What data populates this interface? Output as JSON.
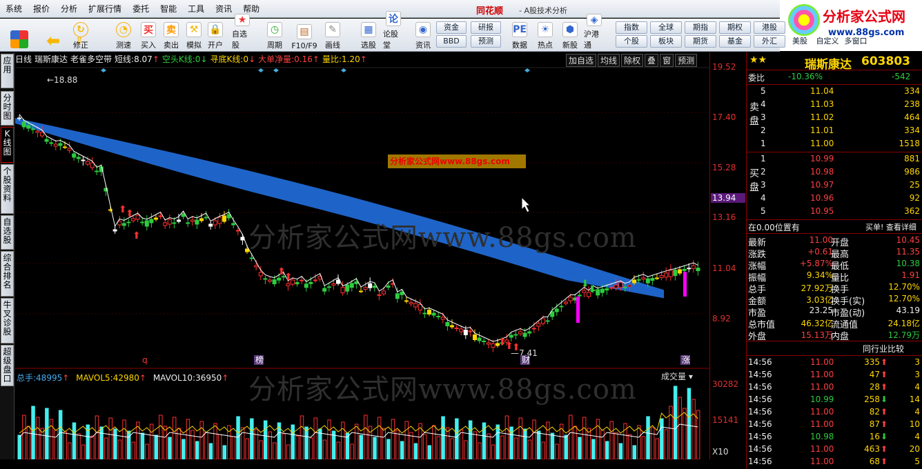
{
  "menu": [
    "系统",
    "报价",
    "分析",
    "扩展行情",
    "委托",
    "智能",
    "工具",
    "资讯",
    "帮助"
  ],
  "app": {
    "brand": "同花顺",
    "subtitle": "- A股技术分析"
  },
  "logo": {
    "line1": "分析家公式网",
    "line2": "www.88gs.com"
  },
  "toolbar": {
    "buttons": [
      "买入",
      "卖出",
      "模拟",
      "开户",
      "自选股",
      "周期",
      "F10/F9",
      "画线",
      "选股",
      "论股堂",
      "资讯",
      "数据",
      "热点",
      "新股",
      "沪港通"
    ],
    "fund": [
      "资金",
      "研报",
      "BBD",
      "预测"
    ],
    "right": [
      "指数",
      "全球",
      "期指",
      "期权",
      "港股",
      "个股",
      "板块",
      "期货",
      "基金",
      "外汇",
      "美股",
      "自定义",
      "多窗口"
    ]
  },
  "sidebar": [
    "应用",
    "分时图",
    "K线图",
    "个股资料",
    "自选股",
    "综合排名",
    "牛叉诊股",
    "超级盘口"
  ],
  "kinfo": {
    "period": "日线",
    "name": "瑞斯康达",
    "indicator": "老雀多空带",
    "short_label": "短线:",
    "short_val": "8.07",
    "kong_label": "空头K线:",
    "kong_val": "0",
    "xun_label": "寻底K线:",
    "xun_val": "0",
    "da_label": "大单净量:",
    "da_val": "0.16",
    "lb_label": "量比:",
    "lb_val": "1.20"
  },
  "rtools": [
    "加自选",
    "均线",
    "除权",
    "叠",
    "窗",
    "预测"
  ],
  "axis": {
    "labels": [
      "19.52",
      "17.40",
      "15.28",
      "13.16",
      "11.04",
      "8.92"
    ],
    "current": "13.94",
    "vol": [
      "30282",
      "15141",
      "X10"
    ]
  },
  "marks": {
    "high": "18.88",
    "low": "7.41",
    "m1": "q",
    "m2": "榜",
    "m3": "财",
    "m4": "涨"
  },
  "watermark": {
    "main": "分析家公式网www.88gs.com",
    "box": "分析家公式网www.88gs.com"
  },
  "vol": {
    "total_label": "总手:",
    "total": "48995",
    "ma5_label": "MAVOL5:",
    "ma5": "42980",
    "ma10_label": "MAVOL10:",
    "ma10": "36950",
    "sel": "成交量"
  },
  "quote": {
    "name": "瑞斯康达",
    "code": "603803",
    "wb_label": "委比",
    "wb": "-10.36%",
    "wc": "-542",
    "sell_label": "卖盘",
    "buy_label": "买盘",
    "sells": [
      {
        "n": "5",
        "p": "11.04",
        "v": "334"
      },
      {
        "n": "4",
        "p": "11.03",
        "v": "238"
      },
      {
        "n": "3",
        "p": "11.02",
        "v": "464"
      },
      {
        "n": "2",
        "p": "11.01",
        "v": "334"
      },
      {
        "n": "1",
        "p": "11.00",
        "v": "1518"
      }
    ],
    "buys": [
      {
        "n": "1",
        "p": "10.99",
        "v": "881"
      },
      {
        "n": "2",
        "p": "10.98",
        "v": "986"
      },
      {
        "n": "3",
        "p": "10.97",
        "v": "25"
      },
      {
        "n": "4",
        "p": "10.96",
        "v": "92"
      },
      {
        "n": "5",
        "p": "10.95",
        "v": "362"
      }
    ],
    "pos": "在0.00位置有",
    "detail": "买单! 查看详细",
    "stats": [
      [
        "最新",
        "11.00",
        "开盘",
        "10.45"
      ],
      [
        "涨跌",
        "+0.61",
        "最高",
        "11.35"
      ],
      [
        "涨幅",
        "+5.87%",
        "最低",
        "10.38"
      ],
      [
        "振幅",
        "9.34%",
        "量比",
        "1.91"
      ],
      [
        "总手",
        "27.92万",
        "换手",
        "12.70%"
      ],
      [
        "金额",
        "3.03亿",
        "换手(实)",
        "12.70%"
      ],
      [
        "市盈",
        "23.25",
        "市盈(动)",
        "43.19"
      ],
      [
        "总市值",
        "46.32亿",
        "流通值",
        "24.18亿"
      ],
      [
        "外盘",
        "15.13万",
        "内盘",
        "12.79万"
      ]
    ],
    "peer": "同行业比较",
    "ticks": [
      [
        "14:56",
        "11.00",
        "335",
        "3"
      ],
      [
        "14:56",
        "11.00",
        "47",
        "3"
      ],
      [
        "14:56",
        "11.00",
        "28",
        "4"
      ],
      [
        "14:56",
        "10.99",
        "258",
        "14"
      ],
      [
        "14:56",
        "11.00",
        "82",
        "4"
      ],
      [
        "14:56",
        "11.00",
        "87",
        "10"
      ],
      [
        "14:56",
        "10.98",
        "16",
        "4"
      ],
      [
        "14:56",
        "11.00",
        "463",
        "20"
      ],
      [
        "14:56",
        "11.00",
        "68",
        "5"
      ]
    ]
  }
}
